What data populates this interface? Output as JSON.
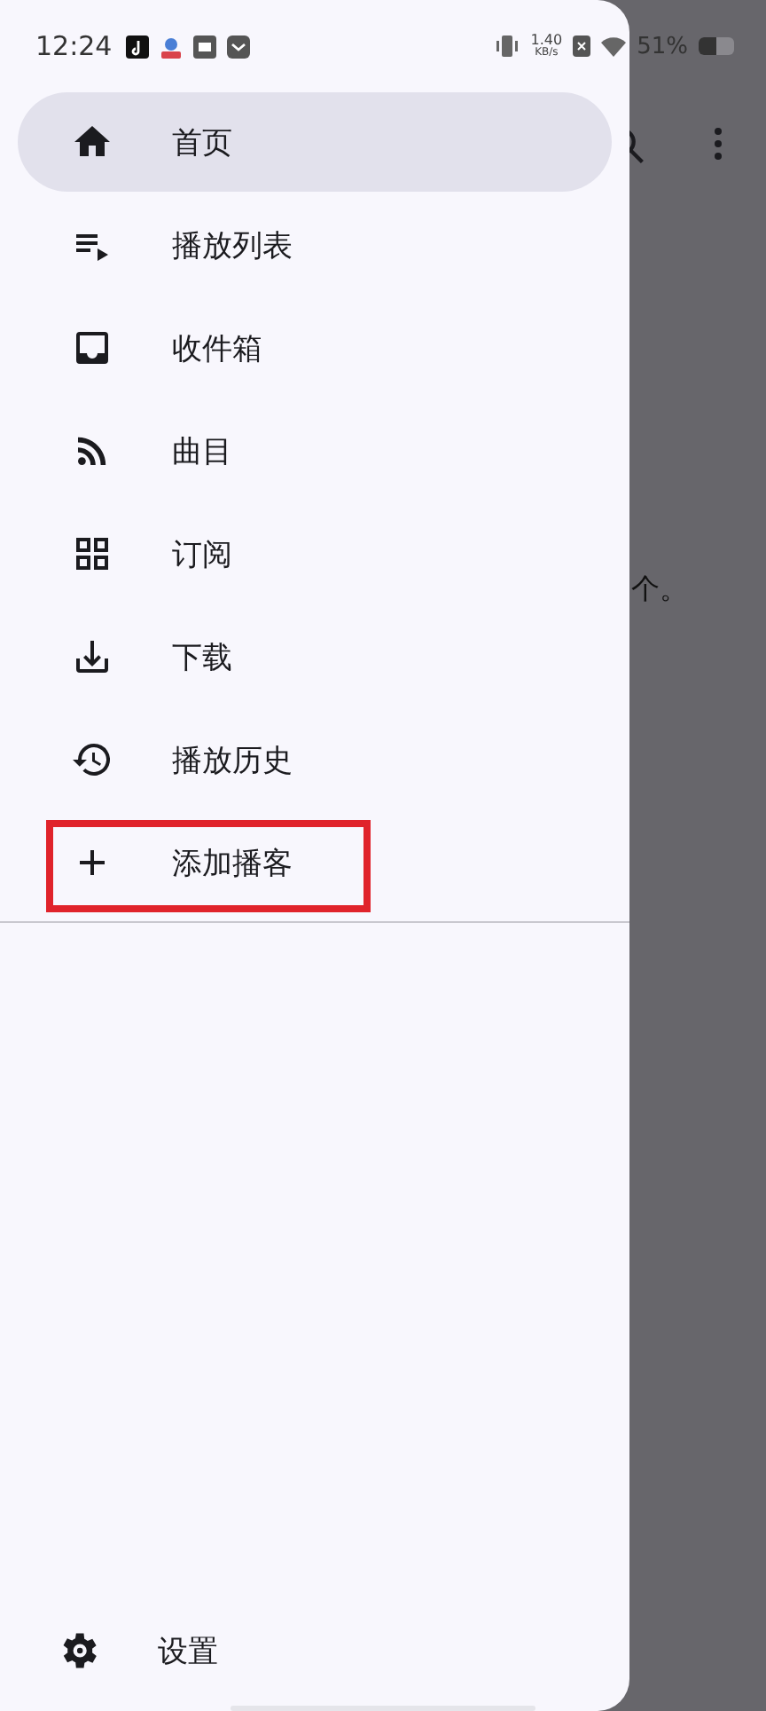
{
  "status_bar": {
    "time": "12:24",
    "speed_value": "1.40",
    "speed_unit": "KB/s",
    "battery": "51%"
  },
  "background": {
    "text": "个。"
  },
  "drawer": {
    "items": [
      {
        "label": "首页",
        "selected": true,
        "highlighted": false
      },
      {
        "label": "播放列表",
        "selected": false,
        "highlighted": false
      },
      {
        "label": "收件箱",
        "selected": false,
        "highlighted": false
      },
      {
        "label": "曲目",
        "selected": false,
        "highlighted": false
      },
      {
        "label": "订阅",
        "selected": false,
        "highlighted": false
      },
      {
        "label": "下载",
        "selected": false,
        "highlighted": false
      },
      {
        "label": "播放历史",
        "selected": false,
        "highlighted": false
      },
      {
        "label": "添加播客",
        "selected": false,
        "highlighted": true
      }
    ],
    "settings": {
      "label": "设置"
    }
  }
}
